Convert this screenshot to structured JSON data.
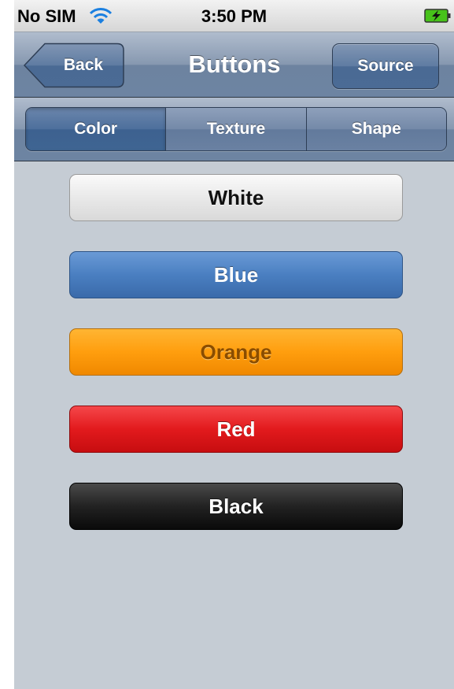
{
  "status_bar": {
    "carrier": "No SIM",
    "time": "3:50 PM",
    "wifi_icon": "wifi-icon",
    "battery_icon": "battery-charging-icon"
  },
  "nav_bar": {
    "back_label": "Back",
    "title": "Buttons",
    "source_label": "Source"
  },
  "segmented_control": {
    "segments": [
      "Color",
      "Texture",
      "Shape"
    ],
    "selected": "Color"
  },
  "buttons": [
    {
      "label": "White",
      "color": "#e9e9e9"
    },
    {
      "label": "Blue",
      "color": "#4a7fc1"
    },
    {
      "label": "Orange",
      "color": "#ff9e0e"
    },
    {
      "label": "Red",
      "color": "#e21a1d"
    },
    {
      "label": "Black",
      "color": "#222222"
    }
  ]
}
